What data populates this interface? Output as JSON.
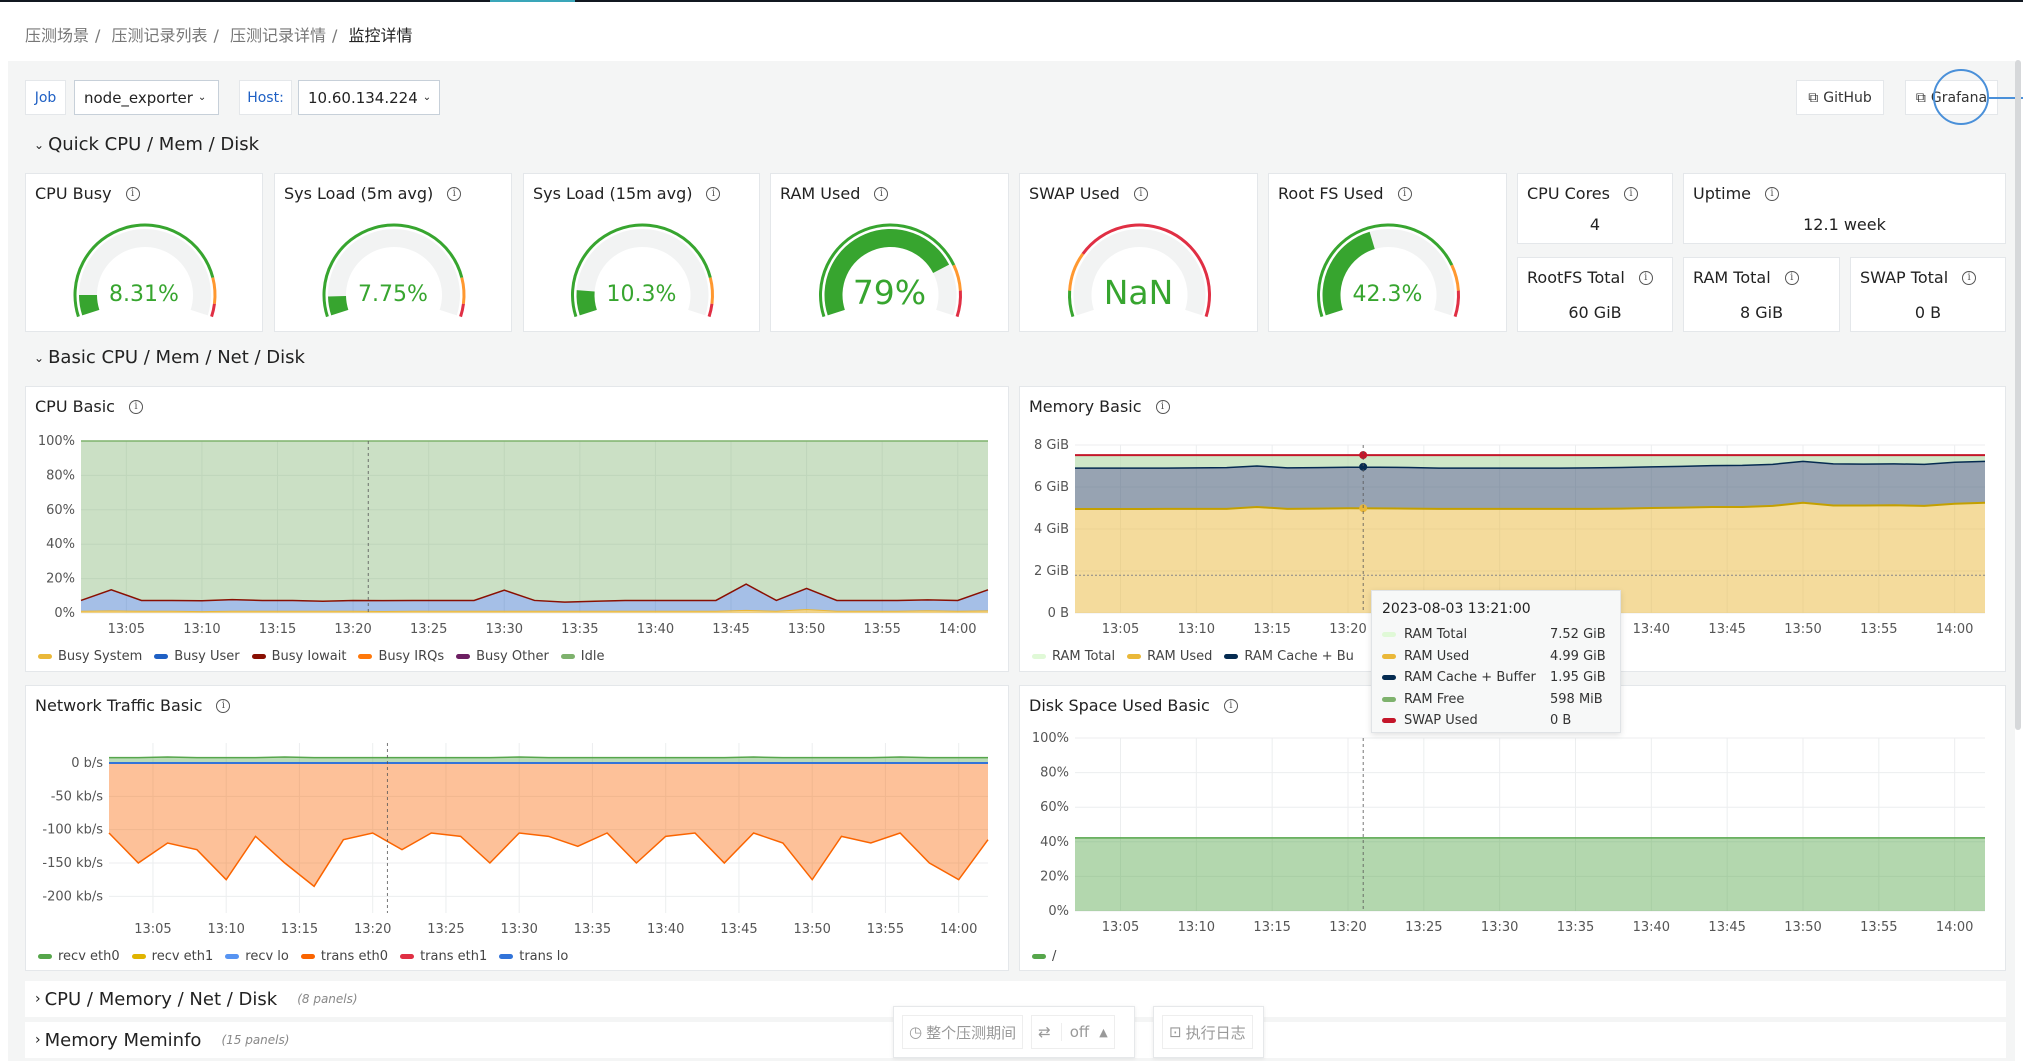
{
  "breadcrumb": [
    "压测场景",
    "压测记录列表",
    "压测记录详情",
    "监控详情"
  ],
  "filters": {
    "job_label": "Job",
    "job_value": "node_exporter",
    "host_label": "Host:",
    "host_value": "10.60.134.224"
  },
  "links": {
    "github": "GitHub",
    "grafana": "Grafana",
    "icon": "external-link-icon"
  },
  "sections": {
    "quick": "Quick CPU / Mem / Disk",
    "basic": "Basic CPU / Mem / Net / Disk"
  },
  "gauges": [
    {
      "title": "CPU Busy",
      "value": "8.31%",
      "percent": 8.31,
      "thresholds": [
        [
          "#37a52f",
          85
        ],
        [
          "#ff9830",
          95
        ],
        [
          "#e02f44",
          100
        ]
      ]
    },
    {
      "title": "Sys Load (5m avg)",
      "value": "7.75%",
      "percent": 7.75,
      "thresholds": [
        [
          "#37a52f",
          85
        ],
        [
          "#ff9830",
          95
        ],
        [
          "#e02f44",
          100
        ]
      ]
    },
    {
      "title": "Sys Load (15m avg)",
      "value": "10.3%",
      "percent": 10.3,
      "thresholds": [
        [
          "#37a52f",
          85
        ],
        [
          "#ff9830",
          95
        ],
        [
          "#e02f44",
          100
        ]
      ]
    },
    {
      "title": "RAM Used",
      "value": "79%",
      "percent": 79,
      "thresholds": [
        [
          "#37a52f",
          80
        ],
        [
          "#ff9830",
          90
        ],
        [
          "#e02f44",
          100
        ]
      ]
    },
    {
      "title": "SWAP Used",
      "value": "NaN",
      "percent": 0,
      "thresholds": [
        [
          "#37a52f",
          10
        ],
        [
          "#ff9830",
          25
        ],
        [
          "#e02f44",
          100
        ]
      ]
    },
    {
      "title": "Root FS Used",
      "value": "42.3%",
      "percent": 42.3,
      "thresholds": [
        [
          "#37a52f",
          80
        ],
        [
          "#ff9830",
          90
        ],
        [
          "#e02f44",
          100
        ]
      ]
    }
  ],
  "stats": [
    {
      "title": "CPU Cores",
      "value": "4"
    },
    {
      "title": "Uptime",
      "value": "12.1 week"
    },
    {
      "title": "RootFS Total",
      "value": "60 GiB"
    },
    {
      "title": "RAM Total",
      "value": "8 GiB"
    },
    {
      "title": "SWAP Total",
      "value": "0 B"
    }
  ],
  "chart_data": [
    {
      "title": "CPU Basic",
      "type": "area",
      "stacked": true,
      "time_range": [
        "13:02",
        "14:02"
      ],
      "sample_start": "13:02",
      "sample_interval_min": 2,
      "x_ticks": [
        "13:05",
        "13:10",
        "13:15",
        "13:20",
        "13:25",
        "13:30",
        "13:35",
        "13:40",
        "13:45",
        "13:50",
        "13:55",
        "14:00"
      ],
      "y_ticks": [
        {
          "v": 0,
          "l": "0%"
        },
        {
          "v": 20,
          "l": "20%"
        },
        {
          "v": 40,
          "l": "40%"
        },
        {
          "v": 60,
          "l": "60%"
        },
        {
          "v": 80,
          "l": "80%"
        },
        {
          "v": 100,
          "l": "100%"
        }
      ],
      "ylim": [
        0,
        100
      ],
      "series": [
        {
          "name": "Busy System",
          "color": "#EAB839",
          "values": [
            1,
            1.2,
            1,
            1,
            0.8,
            1,
            1,
            1,
            1,
            1,
            0.9,
            1,
            1,
            1,
            1,
            1,
            1,
            1,
            1,
            1,
            1,
            1,
            1.5,
            1,
            2,
            1,
            1,
            1,
            1.3,
            1,
            1.2
          ]
        },
        {
          "name": "Busy User",
          "color": "#1F60C4",
          "values": [
            6,
            12,
            6,
            6,
            6,
            6.5,
            6,
            6,
            5.5,
            6,
            6,
            6,
            6,
            6,
            12,
            6,
            5,
            5.5,
            6,
            6,
            6,
            6,
            15,
            6,
            12,
            6,
            6,
            6,
            6,
            6,
            12
          ]
        },
        {
          "name": "Busy Iowait",
          "color": "#890F02",
          "values": [
            0.3
          ]
        },
        {
          "name": "Busy IRQs",
          "color": "#FF780A",
          "values": [
            0
          ]
        },
        {
          "name": "Busy Other",
          "color": "#6D1F62",
          "values": [
            0
          ]
        },
        {
          "name": "Idle",
          "color": "#7EB26D",
          "values": [
            "remainder to 100"
          ]
        }
      ],
      "cursor": "13:21"
    },
    {
      "title": "Memory Basic",
      "type": "area",
      "stacked": true,
      "time_range": [
        "13:02",
        "14:02"
      ],
      "sample_start": "13:02",
      "sample_interval_min": 2,
      "x_ticks": [
        "13:05",
        "13:10",
        "13:15",
        "13:20",
        "13:25",
        "13:30",
        "13:35",
        "13:40",
        "13:45",
        "13:50",
        "13:55",
        "14:00"
      ],
      "y_ticks": [
        {
          "v": 0,
          "l": "0 B"
        },
        {
          "v": 2,
          "l": "2 GiB"
        },
        {
          "v": 4,
          "l": "4 GiB"
        },
        {
          "v": 6,
          "l": "6 GiB"
        },
        {
          "v": 8,
          "l": "8 GiB"
        }
      ],
      "ylim": [
        0,
        8
      ],
      "ram_total": 7.52,
      "reference_line": 1.8,
      "series": [
        {
          "name": "RAM Total",
          "color": "#E0F9D7"
        },
        {
          "name": "RAM Used",
          "color": "#EAB839",
          "values": [
            4.95,
            4.95,
            4.95,
            4.96,
            4.96,
            4.96,
            5.05,
            4.96,
            4.97,
            4.99,
            4.98,
            4.97,
            4.96,
            4.96,
            4.96,
            4.96,
            4.96,
            4.96,
            4.97,
            5.0,
            5.02,
            5.05,
            5.05,
            5.1,
            5.25,
            5.12,
            5.12,
            5.13,
            5.1,
            5.2,
            5.25
          ]
        },
        {
          "name": "RAM Cache + Buffer",
          "color": "#052B51",
          "values": [
            1.95,
            1.95,
            1.95,
            1.94,
            1.95,
            1.96,
            1.95,
            1.95,
            1.95,
            1.95,
            1.96,
            1.96,
            1.94,
            1.94,
            1.94,
            1.94,
            1.94,
            1.95,
            1.96,
            1.96,
            1.96,
            1.97,
            1.98,
            1.98,
            1.97,
            1.98,
            1.97,
            1.97,
            1.98,
            1.98,
            1.97
          ]
        },
        {
          "name": "RAM Free",
          "color": "#7EB26D"
        },
        {
          "name": "SWAP Used",
          "color": "#C4162A",
          "values": [
            0
          ]
        }
      ],
      "legend_visible": [
        "RAM Total",
        "RAM Used",
        "RAM Cache + Bu"
      ],
      "cursor": "13:21",
      "tooltip": {
        "time": "2023-08-03 13:21:00",
        "rows": [
          {
            "name": "RAM Total",
            "value": "7.52 GiB",
            "color": "#E0F9D7"
          },
          {
            "name": "RAM Used",
            "value": "4.99 GiB",
            "color": "#EAB839"
          },
          {
            "name": "RAM Cache + Buffer",
            "value": "1.95 GiB",
            "color": "#052B51"
          },
          {
            "name": "RAM Free",
            "value": "598 MiB",
            "color": "#7EB26D"
          },
          {
            "name": "SWAP Used",
            "value": "0 B",
            "color": "#C4162A"
          }
        ]
      }
    },
    {
      "title": "Network Traffic Basic",
      "type": "area",
      "time_range": [
        "13:02",
        "14:02"
      ],
      "sample_start": "13:02",
      "sample_interval_min": 2,
      "x_ticks": [
        "13:05",
        "13:10",
        "13:15",
        "13:20",
        "13:25",
        "13:30",
        "13:35",
        "13:40",
        "13:45",
        "13:50",
        "13:55",
        "14:00"
      ],
      "y_ticks": [
        {
          "v": 0,
          "l": "0 b/s"
        },
        {
          "v": -50,
          "l": "-50 kb/s"
        },
        {
          "v": -100,
          "l": "-100 kb/s"
        },
        {
          "v": -150,
          "l": "-150 kb/s"
        },
        {
          "v": -200,
          "l": "-200 kb/s"
        }
      ],
      "ylim": [
        -225,
        30
      ],
      "series": [
        {
          "name": "recv eth0",
          "color": "#56A64B",
          "values": [
            8,
            8,
            9,
            8,
            8,
            8,
            9,
            8,
            8,
            8,
            8,
            8,
            8,
            8,
            9,
            8,
            8,
            8,
            8,
            8,
            8,
            8,
            9,
            8,
            8,
            8,
            8,
            9,
            8,
            8,
            8
          ]
        },
        {
          "name": "recv eth1",
          "color": "#E0B400",
          "values": [
            0
          ]
        },
        {
          "name": "recv lo",
          "color": "#5794F2",
          "values": [
            0
          ]
        },
        {
          "name": "trans eth0",
          "color": "#FA6400",
          "values": [
            -105,
            -150,
            -120,
            -130,
            -175,
            -110,
            -150,
            -185,
            -115,
            -105,
            -130,
            -105,
            -110,
            -150,
            -105,
            -110,
            -125,
            -105,
            -150,
            -110,
            -105,
            -150,
            -105,
            -120,
            -175,
            -110,
            -120,
            -105,
            -150,
            -175,
            -115
          ]
        },
        {
          "name": "trans eth1",
          "color": "#E02F44",
          "values": [
            0
          ]
        },
        {
          "name": "trans lo",
          "color": "#3274D9",
          "values": [
            0
          ]
        }
      ],
      "cursor": "13:21"
    },
    {
      "title": "Disk Space Used Basic",
      "type": "area",
      "time_range": [
        "13:02",
        "14:02"
      ],
      "x_ticks": [
        "13:05",
        "13:10",
        "13:15",
        "13:20",
        "13:25",
        "13:30",
        "13:35",
        "13:40",
        "13:45",
        "13:50",
        "13:55",
        "14:00"
      ],
      "y_ticks": [
        {
          "v": 0,
          "l": "0%"
        },
        {
          "v": 20,
          "l": "20%"
        },
        {
          "v": 40,
          "l": "40%"
        },
        {
          "v": 60,
          "l": "60%"
        },
        {
          "v": 80,
          "l": "80%"
        },
        {
          "v": 100,
          "l": "100%"
        }
      ],
      "ylim": [
        0,
        100
      ],
      "series": [
        {
          "name": "/",
          "color": "#56A64B",
          "values": [
            42.3
          ]
        }
      ],
      "cursor": "13:21"
    }
  ],
  "rows": [
    {
      "title": "CPU / Memory / Net / Disk",
      "sub": "(8 panels)"
    },
    {
      "title": "Memory Meminfo",
      "sub": "(15 panels)"
    }
  ],
  "dock": {
    "range": "整个压测期间",
    "refresh": "off",
    "log": "执行日志"
  }
}
